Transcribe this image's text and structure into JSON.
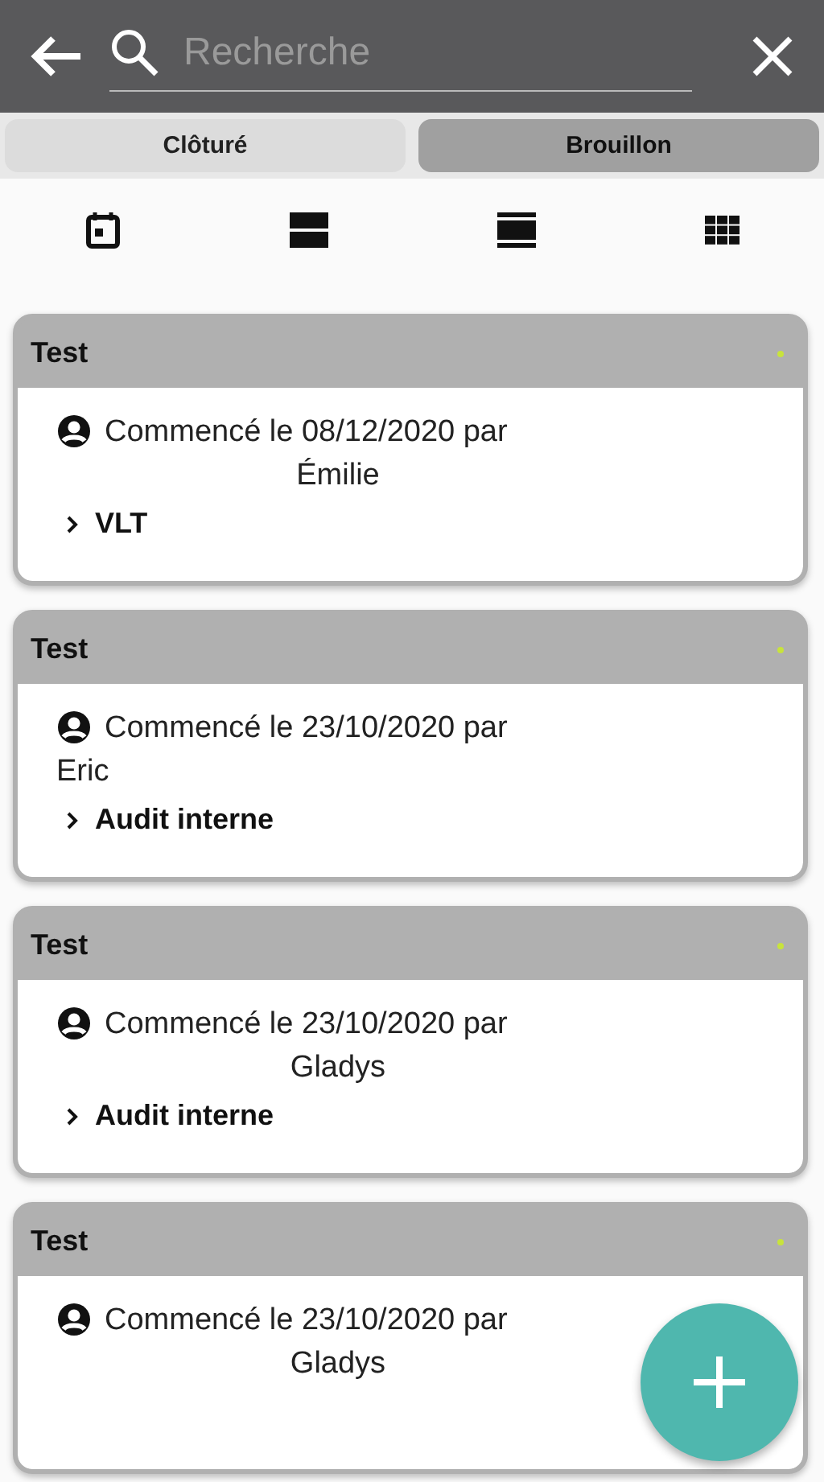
{
  "search": {
    "placeholder": "Recherche"
  },
  "tabs": [
    {
      "label": "Clôturé",
      "selected": false
    },
    {
      "label": "Brouillon",
      "selected": true
    }
  ],
  "view_modes": [
    {
      "kind": "calendar"
    },
    {
      "kind": "large"
    },
    {
      "kind": "list"
    },
    {
      "kind": "grid"
    }
  ],
  "cards": [
    {
      "title": "Test",
      "color": "#c8e33c",
      "started": "Commencé le 08/12/2020 par",
      "author": "Émilie",
      "author_centered": true,
      "category": "VLT"
    },
    {
      "title": "Test",
      "color": "#c8e33c",
      "started": "Commencé le 23/10/2020 par",
      "author": "Eric",
      "author_centered": false,
      "category": "Audit interne"
    },
    {
      "title": "Test",
      "color": "#c8e33c",
      "started": "Commencé le 23/10/2020 par",
      "author": "Gladys",
      "author_centered": true,
      "category": "Audit interne"
    },
    {
      "title": "Test",
      "color": "#c8e33c",
      "started": "Commencé le 23/10/2020 par",
      "author": "Gladys",
      "author_centered": true
    }
  ],
  "fab": {
    "kind": "add"
  }
}
